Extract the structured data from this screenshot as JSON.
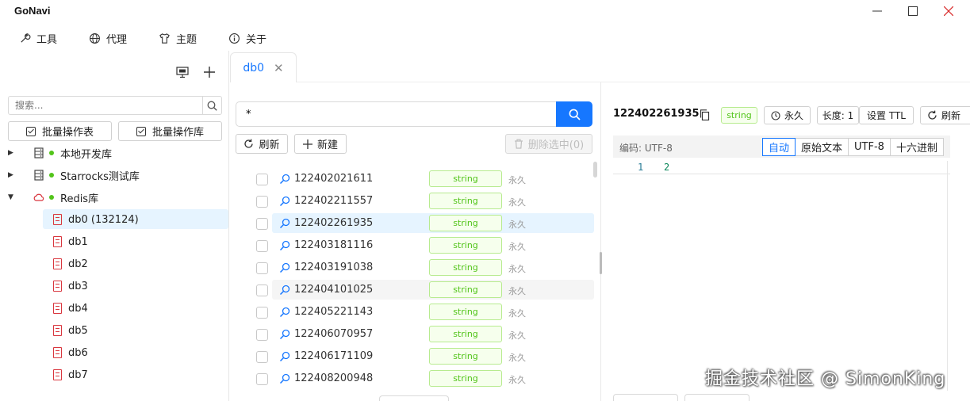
{
  "window": {
    "title": "GoNavi"
  },
  "menu": [
    {
      "label": "工具",
      "icon": "wrench-icon"
    },
    {
      "label": "代理",
      "icon": "globe-icon"
    },
    {
      "label": "主题",
      "icon": "shirt-icon"
    },
    {
      "label": "关于",
      "icon": "info-icon"
    }
  ],
  "sidebar": {
    "search_placeholder": "搜索...",
    "batch_table_label": "批量操作表",
    "batch_db_label": "批量操作库",
    "connections": [
      {
        "label": "本地开发库",
        "expanded": false,
        "icon": "server-icon",
        "status": "connected"
      },
      {
        "label": "Starrocks测试库",
        "expanded": false,
        "icon": "server-icon",
        "status": "connected"
      },
      {
        "label": "Redis库",
        "expanded": true,
        "icon": "cloud-icon",
        "status": "connected"
      }
    ],
    "databases": [
      {
        "label": "db0 (132124)",
        "selected": true
      },
      {
        "label": "db1"
      },
      {
        "label": "db2"
      },
      {
        "label": "db3"
      },
      {
        "label": "db4"
      },
      {
        "label": "db5"
      },
      {
        "label": "db6"
      },
      {
        "label": "db7"
      }
    ]
  },
  "tabs": [
    {
      "label": "db0",
      "active": true
    }
  ],
  "keys_panel": {
    "pattern_value": "*",
    "refresh_label": "刷新",
    "new_label": "新建",
    "delete_label": "删除选中(0)",
    "keys": [
      {
        "name": "122402021611",
        "type": "string",
        "ttl": "永久"
      },
      {
        "name": "122402211557",
        "type": "string",
        "ttl": "永久"
      },
      {
        "name": "122402261935",
        "type": "string",
        "ttl": "永久",
        "selected": true
      },
      {
        "name": "122403181116",
        "type": "string",
        "ttl": "永久"
      },
      {
        "name": "122403191038",
        "type": "string",
        "ttl": "永久"
      },
      {
        "name": "122404101025",
        "type": "string",
        "ttl": "永久",
        "hover": true
      },
      {
        "name": "122405221143",
        "type": "string",
        "ttl": "永久"
      },
      {
        "name": "122406070957",
        "type": "string",
        "ttl": "永久"
      },
      {
        "name": "122406171109",
        "type": "string",
        "ttl": "永久"
      },
      {
        "name": "122408200948",
        "type": "string",
        "ttl": "永久"
      }
    ]
  },
  "detail": {
    "key": "122402261935",
    "type": "string",
    "ttl_label": "永久",
    "length_label": "长度: 1",
    "set_ttl_label": "设置 TTL",
    "refresh_label": "刷新",
    "encoding_label": "编码: UTF-8",
    "view_modes": [
      "自动",
      "原始文本",
      "UTF-8",
      "十六进制"
    ],
    "active_view_mode": "自动",
    "lines": [
      {
        "no": "1",
        "text": "2"
      }
    ]
  },
  "watermark": "掘金技术社区 @ SimonKing",
  "colors": {
    "accent": "#1677ff",
    "tag_green": "#52c41a",
    "db_red": "#d9363e",
    "status_green": "#52c41a"
  }
}
